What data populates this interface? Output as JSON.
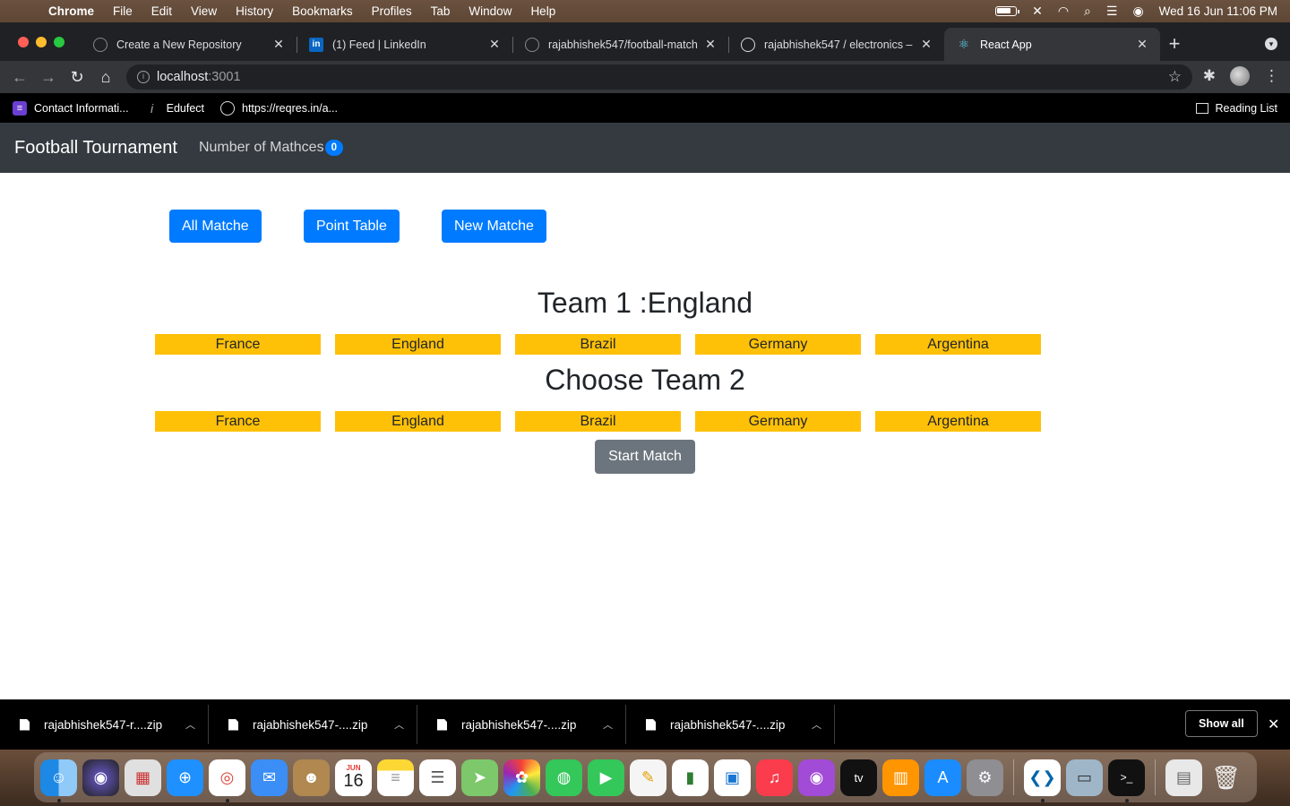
{
  "menubar": {
    "app": "Chrome",
    "items": [
      "File",
      "Edit",
      "View",
      "History",
      "Bookmarks",
      "Profiles",
      "Tab",
      "Window",
      "Help"
    ],
    "clock": "Wed 16 Jun  11:06 PM"
  },
  "tabs": [
    {
      "title": "Create a New Repository",
      "icon": "github-icon"
    },
    {
      "title": "(1) Feed | LinkedIn",
      "icon": "linkedin-icon"
    },
    {
      "title": "rajabhishek547/football-match",
      "icon": "github-icon"
    },
    {
      "title": "rajabhishek547 / electronics –",
      "icon": "globe-icon"
    },
    {
      "title": "React App",
      "icon": "react-icon"
    }
  ],
  "address": {
    "host": "localhost",
    "port": ":3001"
  },
  "bookmarks": {
    "items": [
      "Contact Informati...",
      "Edufect",
      "https://reqres.in/a..."
    ],
    "reading_list": "Reading List"
  },
  "app": {
    "brand": "Football Tournament",
    "count_label": "Number of Mathces",
    "count": "0",
    "buttons": {
      "all": "All Matche",
      "points": "Point Table",
      "new": "New Matche"
    },
    "team1_heading": "Team 1 :England",
    "team2_heading": "Choose Team 2",
    "teams": [
      "France",
      "England",
      "Brazil",
      "Germany",
      "Argentina"
    ],
    "start": "Start Match"
  },
  "downloads": {
    "files": [
      "rajabhishek547-r....zip",
      "rajabhishek547-....zip",
      "rajabhishek547-....zip",
      "rajabhishek547-....zip"
    ],
    "show_all": "Show all"
  },
  "calendar_dock": {
    "month": "JUN",
    "day": "16"
  },
  "colors": {
    "navbar": "#343a40",
    "primary": "#007bff",
    "warning": "#ffc107",
    "secondary": "#6c757d"
  }
}
